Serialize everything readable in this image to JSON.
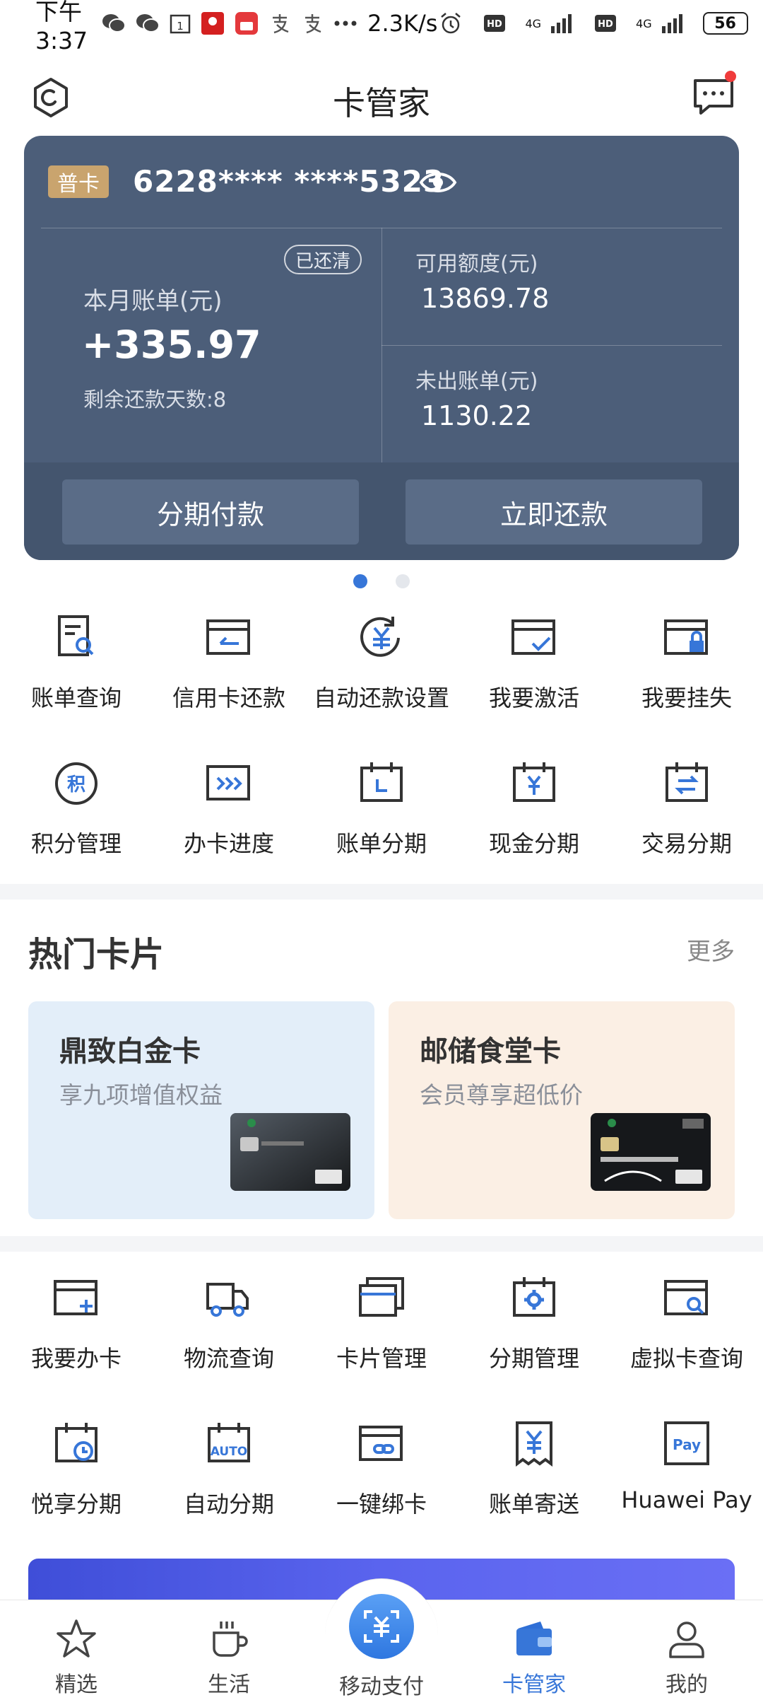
{
  "status_bar": {
    "time": "下午3:37",
    "speed": "2.3K/s",
    "network_1": "4G",
    "network_2": "4G",
    "battery": "56"
  },
  "header": {
    "title": "卡管家"
  },
  "card": {
    "type_badge": "普卡",
    "card_number": "6228**** ****5323",
    "paid_badge": "已还清",
    "bill_label": "本月账单(元)",
    "bill_amount": "+335.97",
    "days_left": "剩余还款天数:8",
    "available_label": "可用额度(元)",
    "available_amount": "13869.78",
    "unbilled_label": "未出账单(元)",
    "unbilled_amount": "1130.22",
    "installment_button": "分期付款",
    "repay_button": "立即还款"
  },
  "pager": {
    "total": 2,
    "active_index": 0
  },
  "services_1": [
    {
      "label": "账单查询",
      "icon": "bill-search-icon"
    },
    {
      "label": "信用卡还款",
      "icon": "card-repay-icon"
    },
    {
      "label": "自动还款设置",
      "icon": "auto-repay-icon"
    },
    {
      "label": "我要激活",
      "icon": "card-activate-icon"
    },
    {
      "label": "我要挂失",
      "icon": "card-lock-icon"
    },
    {
      "label": "积分管理",
      "icon": "points-icon"
    },
    {
      "label": "办卡进度",
      "icon": "progress-icon"
    },
    {
      "label": "账单分期",
      "icon": "bill-installment-icon"
    },
    {
      "label": "现金分期",
      "icon": "cash-installment-icon"
    },
    {
      "label": "交易分期",
      "icon": "trade-installment-icon"
    }
  ],
  "hot_cards": {
    "title": "热门卡片",
    "more": "更多",
    "items": [
      {
        "title": "鼎致白金卡",
        "subtitle": "享九项增值权益"
      },
      {
        "title": "邮储食堂卡",
        "subtitle": "会员尊享超低价"
      }
    ]
  },
  "services_2": [
    {
      "label": "我要办卡",
      "icon": "apply-card-icon"
    },
    {
      "label": "物流查询",
      "icon": "truck-icon"
    },
    {
      "label": "卡片管理",
      "icon": "card-manage-icon"
    },
    {
      "label": "分期管理",
      "icon": "installment-settings-icon"
    },
    {
      "label": "虚拟卡查询",
      "icon": "virtual-card-search-icon"
    },
    {
      "label": "悦享分期",
      "icon": "calendar-clock-icon"
    },
    {
      "label": "自动分期",
      "icon": "auto-calendar-icon"
    },
    {
      "label": "一键绑卡",
      "icon": "card-link-icon"
    },
    {
      "label": "账单寄送",
      "icon": "receipt-icon"
    },
    {
      "label": "Huawei Pay",
      "icon": "huawei-pay-icon"
    }
  ],
  "tabbar": {
    "items": [
      {
        "label": "精选",
        "icon": "star-icon"
      },
      {
        "label": "生活",
        "icon": "cup-icon"
      },
      {
        "label": "移动支付",
        "icon": "scan-pay-icon"
      },
      {
        "label": "卡管家",
        "icon": "wallet-icon"
      },
      {
        "label": "我的",
        "icon": "user-icon"
      }
    ],
    "active": "卡管家"
  },
  "colors": {
    "accent": "#3776d8",
    "card_bg": "#4c5e79",
    "badge_gold": "#c9a46e"
  }
}
